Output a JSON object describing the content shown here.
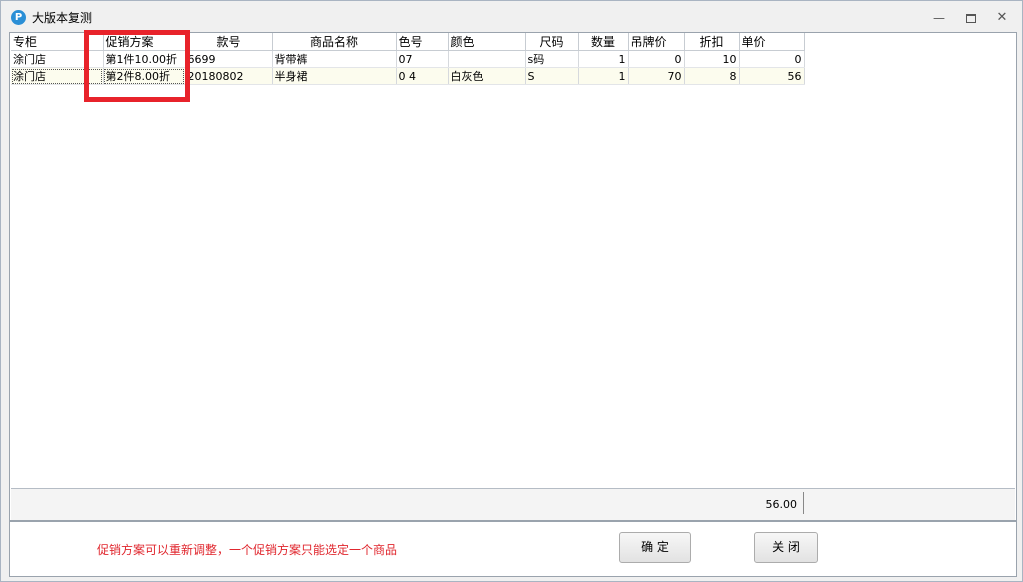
{
  "window": {
    "title": "大版本复测"
  },
  "grid": {
    "columns": [
      "专柜",
      "促销方案",
      "款号",
      "商品名称",
      "色号",
      "颜色",
      "尺码",
      "数量",
      "吊牌价",
      "折扣",
      "单价"
    ],
    "rows": [
      [
        "涂门店",
        "第1件10.00折",
        "6699",
        "背带裤",
        "07",
        "",
        "s码",
        "1",
        "0",
        "10",
        "0"
      ],
      [
        "涂门店",
        "第2件8.00折",
        "20180802",
        "半身裙",
        "0 4",
        "白灰色",
        "S",
        "1",
        "70",
        "8",
        "56"
      ]
    ],
    "total": "56.00"
  },
  "footer": {
    "note": "促销方案可以重新调整，一个促销方案只能选定一个商品",
    "ok_label": "确 定",
    "close_label": "关 闭"
  },
  "colors": {
    "highlight": "#e8232b",
    "note": "#e0262d"
  }
}
